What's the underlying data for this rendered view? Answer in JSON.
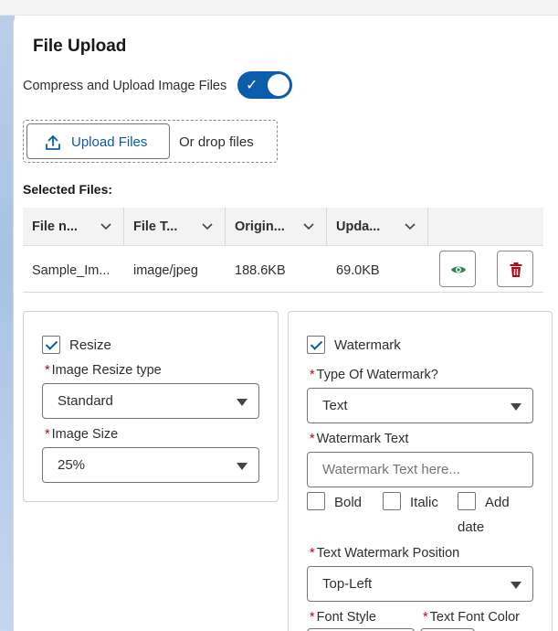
{
  "card": {
    "title": "File Upload",
    "compress_label": "Compress and Upload Image Files",
    "compress_enabled": true,
    "upload_button_label": "Upload Files",
    "drop_text": "Or drop files",
    "selected_label": "Selected Files:"
  },
  "table": {
    "headers": [
      "File n...",
      "File T...",
      "Origin...",
      "Upda..."
    ],
    "rows": [
      {
        "file_name": "Sample_Im...",
        "file_type": "image/jpeg",
        "original_size": "188.6KB",
        "updated_size": "69.0KB"
      }
    ]
  },
  "resize": {
    "checkbox_label": "Resize",
    "checked": true,
    "resize_type_label": "Image Resize type",
    "resize_type_value": "Standard",
    "image_size_label": "Image Size",
    "image_size_value": "25%"
  },
  "watermark": {
    "checkbox_label": "Watermark",
    "checked": true,
    "type_label": "Type Of Watermark?",
    "type_value": "Text",
    "text_label": "Watermark Text",
    "text_placeholder": "Watermark Text here...",
    "bold_label": "Bold",
    "italic_label": "Italic",
    "add_date_label_line1": "Add",
    "add_date_label_line2": "date",
    "position_label": "Text Watermark Position",
    "position_value": "Top-Left",
    "font_style_label": "Font Style",
    "font_color_label": "Text Font Color"
  },
  "colors": {
    "brand": "#0b5cab",
    "required": "#ba0517",
    "view_icon": "#2e844a",
    "delete_icon": "#ba0517"
  },
  "icons": {
    "upload": "upload-icon",
    "sort": "chevron-down-icon",
    "view": "eye-icon",
    "delete": "trash-icon"
  }
}
